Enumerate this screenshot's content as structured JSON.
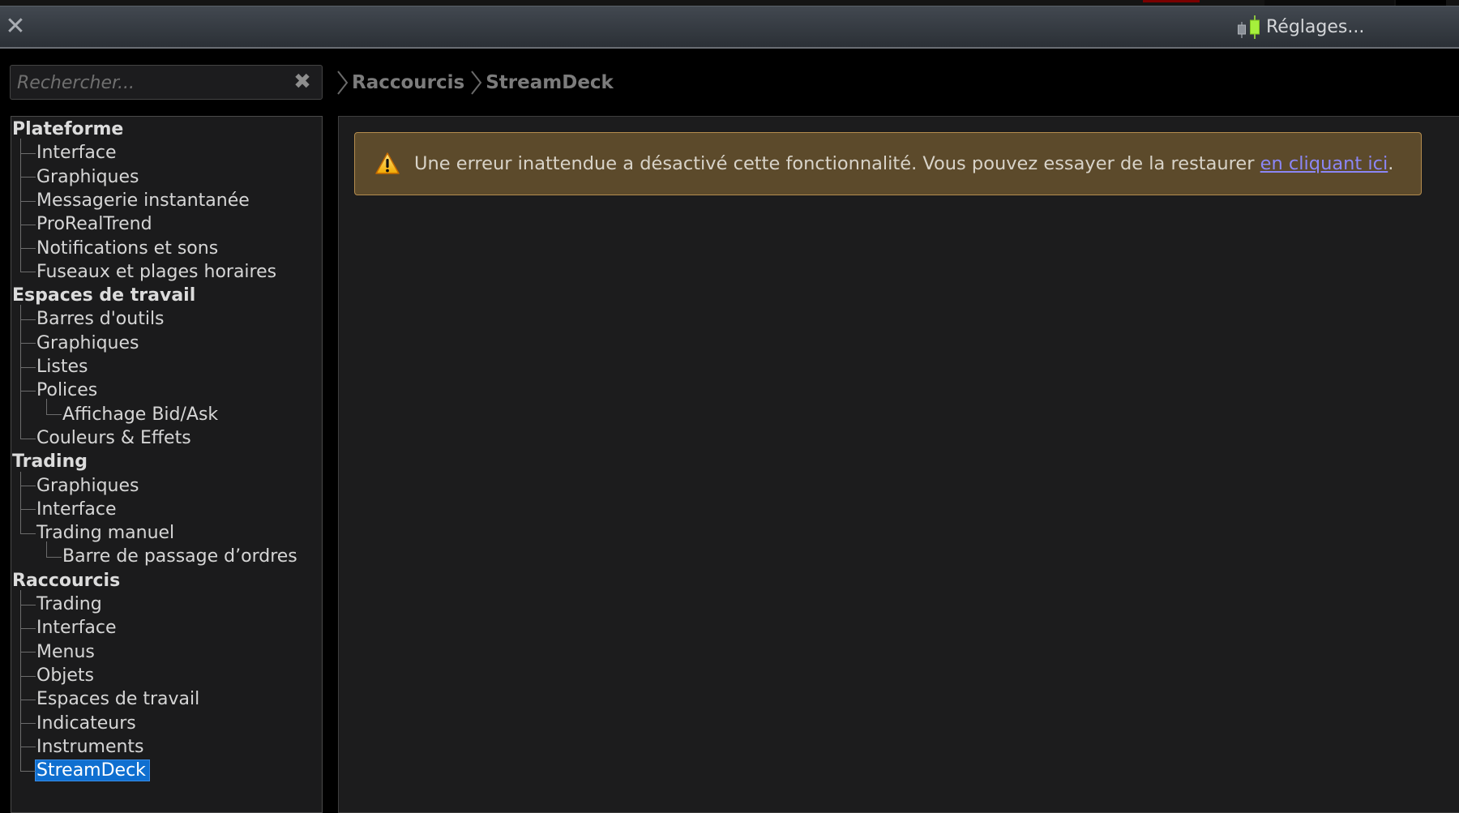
{
  "window": {
    "close_icon": "close-icon",
    "settings_label": "Réglages...",
    "settings_icon": "candlestick-icon"
  },
  "search": {
    "placeholder": "Rechercher...",
    "value": "",
    "clear_icon": "clear-x-icon"
  },
  "breadcrumb": [
    "Raccourcis",
    "StreamDeck"
  ],
  "tree": {
    "groups": [
      {
        "label": "Plateforme",
        "items": [
          {
            "label": "Interface"
          },
          {
            "label": "Graphiques"
          },
          {
            "label": "Messagerie instantanée"
          },
          {
            "label": "ProRealTrend"
          },
          {
            "label": "Notifications et sons"
          },
          {
            "label": "Fuseaux et plages horaires"
          }
        ]
      },
      {
        "label": "Espaces de travail",
        "items": [
          {
            "label": "Barres d'outils"
          },
          {
            "label": "Graphiques"
          },
          {
            "label": "Listes"
          },
          {
            "label": "Polices",
            "children": [
              {
                "label": "Affichage Bid/Ask"
              }
            ]
          },
          {
            "label": "Couleurs & Effets"
          }
        ]
      },
      {
        "label": "Trading",
        "items": [
          {
            "label": "Graphiques"
          },
          {
            "label": "Interface"
          },
          {
            "label": "Trading manuel",
            "children": [
              {
                "label": "Barre de passage d’ordres"
              }
            ]
          }
        ]
      },
      {
        "label": "Raccourcis",
        "items": [
          {
            "label": "Trading"
          },
          {
            "label": "Interface"
          },
          {
            "label": "Menus"
          },
          {
            "label": "Objets"
          },
          {
            "label": "Espaces de travail"
          },
          {
            "label": "Indicateurs"
          },
          {
            "label": "Instruments"
          },
          {
            "label": "StreamDeck",
            "selected": true
          }
        ]
      }
    ]
  },
  "alert": {
    "icon": "warning-icon",
    "message": "Une erreur inattendue a désactivé cette fonctionnalité. Vous pouvez essayer de la restaurer ",
    "link_text": "en cliquant ici",
    "suffix": "."
  },
  "colors": {
    "selection": "#0f6fd0",
    "alert_bg": "#5c4a2b",
    "alert_border": "#b48c4e",
    "link": "#8b86f5",
    "candle_green": "#a6f03c"
  }
}
